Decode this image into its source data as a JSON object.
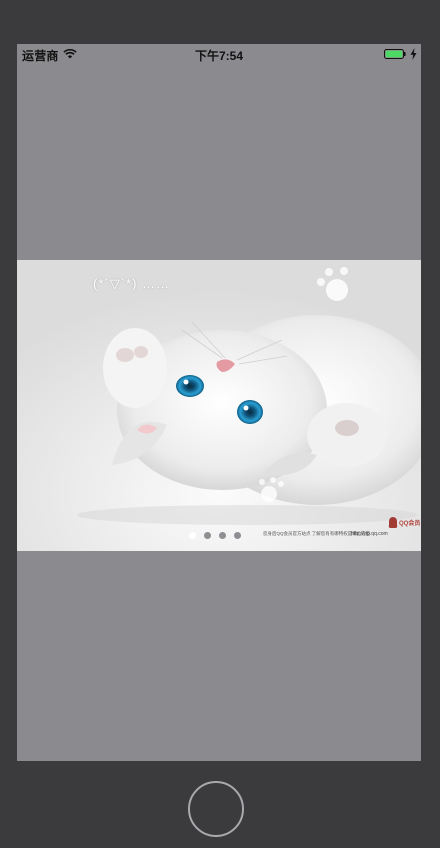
{
  "status_bar": {
    "carrier": "运营商",
    "time": "下午7:54",
    "wifi_icon": "wifi-icon",
    "battery_icon": "battery-icon",
    "charge_icon": "charging-bolt-icon",
    "battery_color": "#4cd964"
  },
  "banner": {
    "image": "white-kitten-lying-on-back-photo",
    "kaomoji": "(*´▽`*) ……",
    "watermark_left": "您身后QQ会员官方站点    了解您有有哪特权是哪位这些",
    "watermark_url": "http://vip.qq.com",
    "watermark_logo": "qq-vip-logo",
    "watermark_logo_text": "QQ会员",
    "page_control": {
      "count": 4,
      "current": 1,
      "active_color": "#ffffff",
      "inactive_color": "#8e8e93"
    }
  },
  "device": {
    "home_button": "home-button"
  },
  "colors": {
    "bezel": "#3b3a3d",
    "screen_background": "#8b8a8e"
  }
}
